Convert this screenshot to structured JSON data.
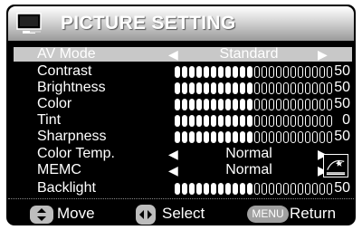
{
  "header": {
    "title": "PICTURE SETTING",
    "icon": "tv-monitor-icon"
  },
  "rows": [
    {
      "label": "AV Mode",
      "type": "option",
      "option": "Standard"
    },
    {
      "label": "Contrast",
      "type": "slider",
      "value": "50",
      "level": 0.5
    },
    {
      "label": "Brightness",
      "type": "slider",
      "value": "50",
      "level": 0.5
    },
    {
      "label": "Color",
      "type": "slider",
      "value": "50",
      "level": 0.5
    },
    {
      "label": "Tint",
      "type": "slider",
      "value": "0",
      "level": 0.5
    },
    {
      "label": "Sharpness",
      "type": "slider",
      "value": "50",
      "level": 0.5
    },
    {
      "label": "Color Temp.",
      "type": "option",
      "option": "Normal"
    },
    {
      "label": "MEMC",
      "type": "option",
      "option": "Normal"
    },
    {
      "label": "Backlight",
      "type": "slider",
      "value": "50",
      "level": 0.5
    }
  ],
  "selected_row": "AV Mode",
  "footer": {
    "move": "Move",
    "select": "Select",
    "menu_badge": "MENU",
    "return": "Return"
  },
  "energy_star": {
    "icon": "energy-star-icon"
  },
  "colors": {
    "panel": "#000000",
    "highlight": "#c8c8c8",
    "text": "#ffffff",
    "menu_badge": "#a0a0a0"
  }
}
